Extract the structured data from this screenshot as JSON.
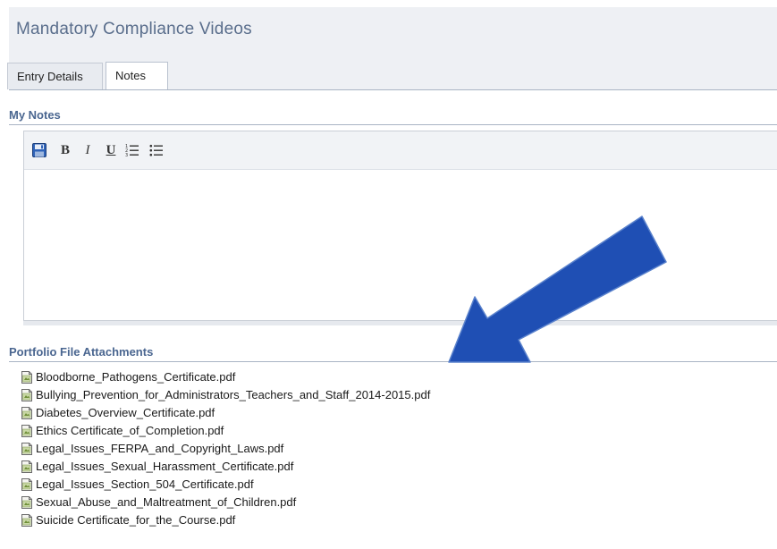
{
  "header": {
    "title": "Mandatory Compliance Videos"
  },
  "tabs": [
    {
      "label": "Entry Details"
    },
    {
      "label": "Notes"
    }
  ],
  "notes": {
    "heading": "My Notes"
  },
  "toolbar": {
    "buttons": [
      {
        "name": "save",
        "icon": "floppy-disk-icon",
        "glyph": ""
      },
      {
        "name": "bold",
        "icon": "bold-icon",
        "glyph": "B"
      },
      {
        "name": "italic",
        "icon": "italic-icon",
        "glyph": "I"
      },
      {
        "name": "underline",
        "icon": "underline-icon",
        "glyph": "U"
      },
      {
        "name": "numbered-list",
        "icon": "numbered-list-icon",
        "glyph": ""
      },
      {
        "name": "bullet-list",
        "icon": "bullet-list-icon",
        "glyph": ""
      }
    ]
  },
  "attachments": {
    "heading": "Portfolio File Attachments",
    "files": [
      "Bloodborne_Pathogens_Certificate.pdf",
      "Bullying_Prevention_for_Administrators_Teachers_and_Staff_2014-2015.pdf",
      "Diabetes_Overview_Certificate.pdf",
      "Ethics Certificate_of_Completion.pdf",
      "Legal_Issues_FERPA_and_Copyright_Laws.pdf",
      "Legal_Issues_Sexual_Harassment_Certificate.pdf",
      "Legal_Issues_Section_504_Certificate.pdf",
      "Sexual_Abuse_and_Maltreatment_of_Children.pdf",
      "Suicide Certificate_for_the_Course.pdf"
    ]
  },
  "colors": {
    "accent_arrow": "#1f4fb4",
    "section_heading": "#4a6690",
    "header_bg": "#eef0f4"
  }
}
